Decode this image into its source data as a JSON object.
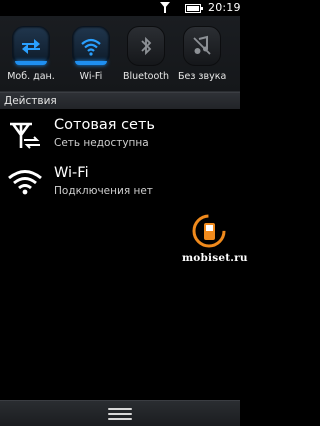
{
  "status_bar": {
    "time": "20:19",
    "signal_icon": "signal-icon",
    "battery_icon": "battery-icon"
  },
  "toggles": [
    {
      "label": "Моб. дан.",
      "icon": "mobile-data-icon",
      "active": true
    },
    {
      "label": "Wi-Fi",
      "icon": "wifi-icon",
      "active": true
    },
    {
      "label": "Bluetooth",
      "icon": "bluetooth-icon",
      "active": false
    },
    {
      "label": "Без звука",
      "icon": "silent-icon",
      "active": false
    }
  ],
  "actions": {
    "title": "Действия",
    "items": [
      {
        "title": "Сотовая сеть",
        "subtitle": "Сеть недоступна",
        "icon": "cellular-network-icon"
      },
      {
        "title": "Wi-Fi",
        "subtitle": "Подключения нет",
        "icon": "wifi-icon"
      }
    ]
  },
  "watermark": {
    "text": "mobiset.ru"
  },
  "colors": {
    "accent": "#1f8ff0",
    "background": "#000000"
  }
}
